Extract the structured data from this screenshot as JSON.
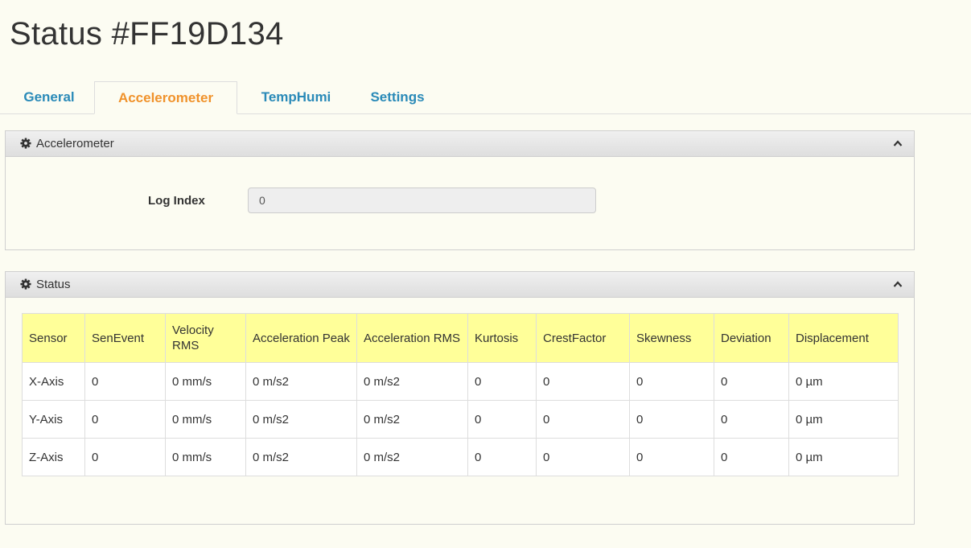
{
  "title": "Status #FF19D134",
  "tabs": [
    {
      "label": "General",
      "active": false
    },
    {
      "label": "Accelerometer",
      "active": true
    },
    {
      "label": "TempHumi",
      "active": false
    },
    {
      "label": "Settings",
      "active": false
    }
  ],
  "accelerometer_panel": {
    "title": "Accelerometer",
    "icon": "gear-icon",
    "collapse_icon": "chevron-up-icon",
    "log_index_label": "Log Index",
    "log_index_value": "0"
  },
  "status_panel": {
    "title": "Status",
    "icon": "gear-icon",
    "collapse_icon": "chevron-up-icon",
    "columns": [
      "Sensor",
      "SenEvent",
      "Velocity RMS",
      "Acceleration Peak",
      "Acceleration RMS",
      "Kurtosis",
      "CrestFactor",
      "Skewness",
      "Deviation",
      "Displacement"
    ],
    "rows": [
      [
        "X-Axis",
        "0",
        "0 mm/s",
        "0 m/s2",
        "0 m/s2",
        "0",
        "0",
        "0",
        "0",
        "0 µm"
      ],
      [
        "Y-Axis",
        "0",
        "0 mm/s",
        "0 m/s2",
        "0 m/s2",
        "0",
        "0",
        "0",
        "0",
        "0 µm"
      ],
      [
        "Z-Axis",
        "0",
        "0 mm/s",
        "0 m/s2",
        "0 m/s2",
        "0",
        "0",
        "0",
        "0",
        "0 µm"
      ]
    ]
  },
  "colors": {
    "page_bg": "#fcfcf2",
    "tab_link": "#2a8ab8",
    "tab_active": "#f0922b",
    "table_header_bg": "#ffff99"
  }
}
